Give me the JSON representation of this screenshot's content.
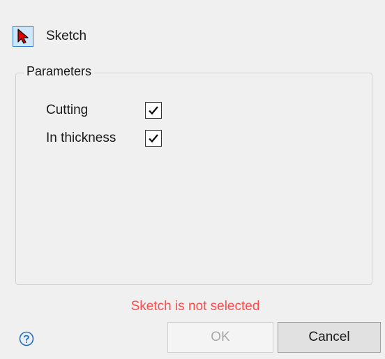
{
  "selector": {
    "label": "Sketch",
    "icon": "red-arrow-cursor-icon",
    "icon_color": "#e00000"
  },
  "parameters": {
    "title": "Parameters",
    "items": [
      {
        "label": "Cutting",
        "checked": true
      },
      {
        "label": "In thickness",
        "checked": true
      }
    ]
  },
  "status": {
    "text": "Sketch is not selected",
    "color": "#ff4b4b"
  },
  "buttons": {
    "help_icon": "question-mark-icon",
    "ok_label": "OK",
    "ok_enabled": false,
    "cancel_label": "Cancel"
  }
}
